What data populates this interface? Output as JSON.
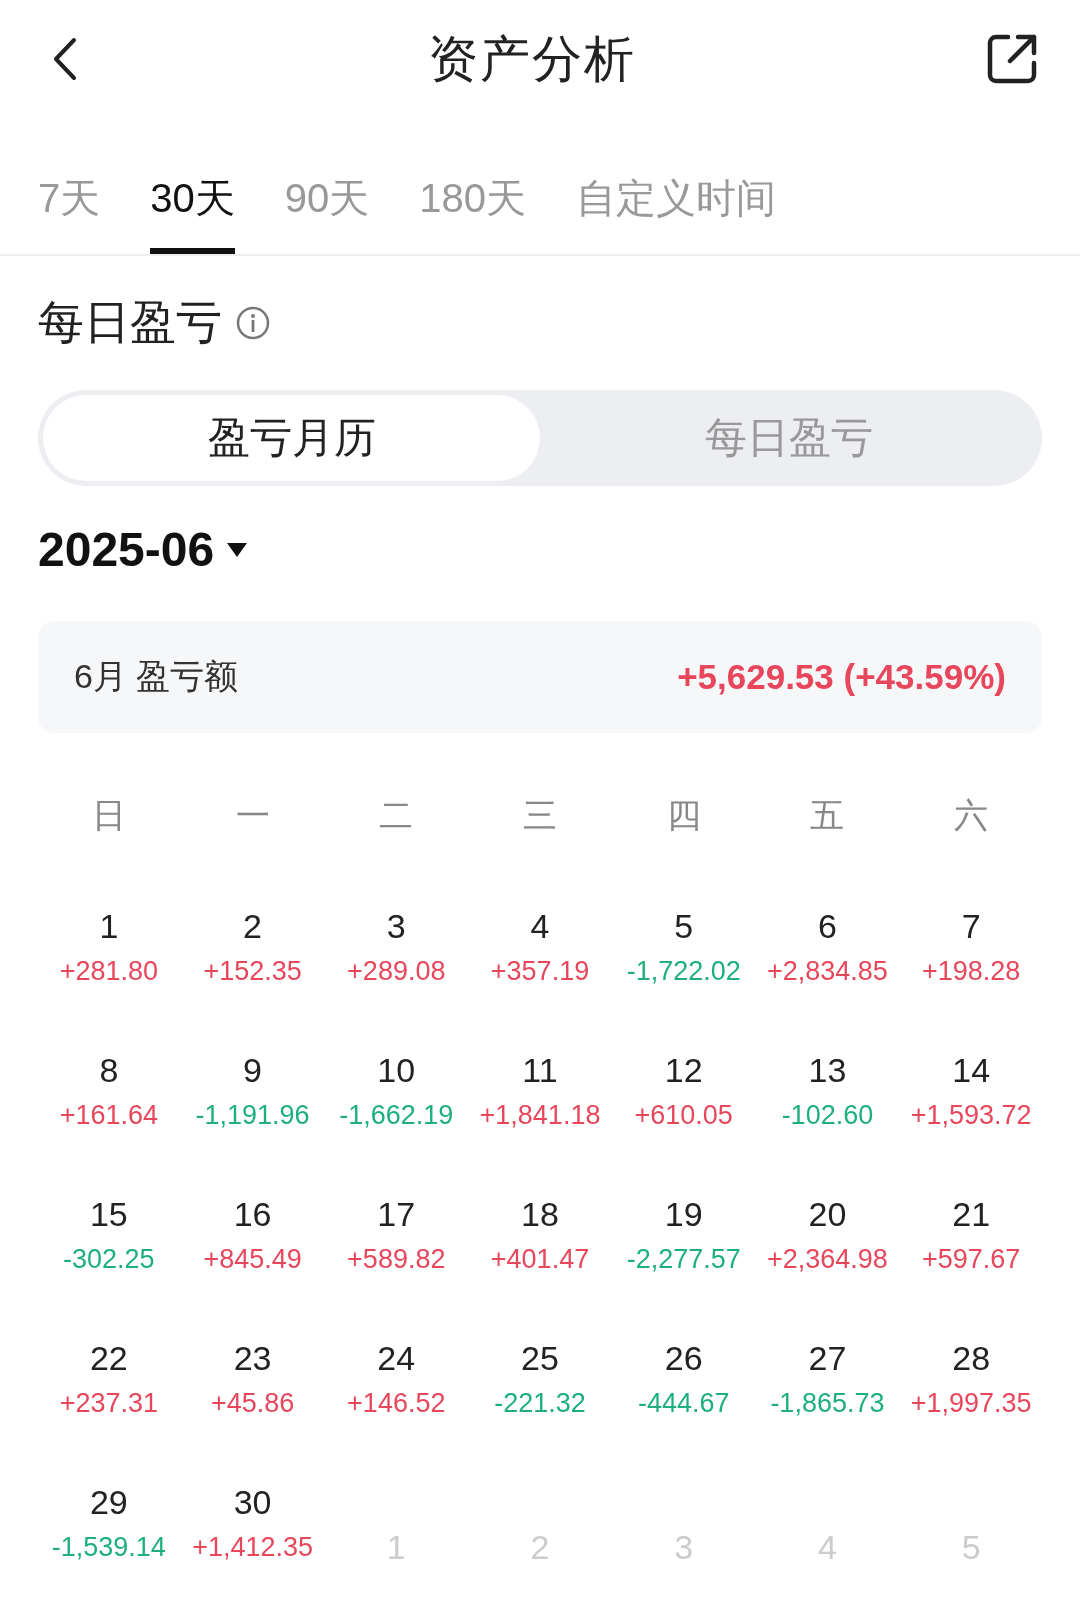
{
  "header": {
    "title": "资产分析"
  },
  "tabs": [
    {
      "label": "7天",
      "selected": false
    },
    {
      "label": "30天",
      "selected": true
    },
    {
      "label": "90天",
      "selected": false
    },
    {
      "label": "180天",
      "selected": false
    },
    {
      "label": "自定义时间",
      "selected": false
    }
  ],
  "section": {
    "title": "每日盈亏"
  },
  "view_switch": [
    {
      "label": "盈亏月历",
      "selected": true
    },
    {
      "label": "每日盈亏",
      "selected": false
    }
  ],
  "month": "2025-06",
  "summary": {
    "label": "6月 盈亏额",
    "value": "+5,629.53 (+43.59%)",
    "color": "#e8465b"
  },
  "weekdays": [
    "日",
    "一",
    "二",
    "三",
    "四",
    "五",
    "六"
  ],
  "days": [
    {
      "kind": "day",
      "day": "1",
      "value": "+281.80",
      "color": "#e8465b"
    },
    {
      "kind": "day",
      "day": "2",
      "value": "+152.35",
      "color": "#e8465b"
    },
    {
      "kind": "day",
      "day": "3",
      "value": "+289.08",
      "color": "#e8465b"
    },
    {
      "kind": "day",
      "day": "4",
      "value": "+357.19",
      "color": "#e8465b"
    },
    {
      "kind": "day",
      "day": "5",
      "value": "-1,722.02",
      "color": "#1eb07c"
    },
    {
      "kind": "day",
      "day": "6",
      "value": "+2,834.85",
      "color": "#e8465b"
    },
    {
      "kind": "day",
      "day": "7",
      "value": "+198.28",
      "color": "#e8465b"
    },
    {
      "kind": "day",
      "day": "8",
      "value": "+161.64",
      "color": "#e8465b"
    },
    {
      "kind": "day",
      "day": "9",
      "value": "-1,191.96",
      "color": "#1eb07c"
    },
    {
      "kind": "day",
      "day": "10",
      "value": "-1,662.19",
      "color": "#1eb07c"
    },
    {
      "kind": "day",
      "day": "11",
      "value": "+1,841.18",
      "color": "#e8465b"
    },
    {
      "kind": "day",
      "day": "12",
      "value": "+610.05",
      "color": "#e8465b"
    },
    {
      "kind": "day",
      "day": "13",
      "value": "-102.60",
      "color": "#1eb07c"
    },
    {
      "kind": "day",
      "day": "14",
      "value": "+1,593.72",
      "color": "#e8465b"
    },
    {
      "kind": "day",
      "day": "15",
      "value": "-302.25",
      "color": "#1eb07c"
    },
    {
      "kind": "day",
      "day": "16",
      "value": "+845.49",
      "color": "#e8465b"
    },
    {
      "kind": "day",
      "day": "17",
      "value": "+589.82",
      "color": "#e8465b"
    },
    {
      "kind": "day",
      "day": "18",
      "value": "+401.47",
      "color": "#e8465b"
    },
    {
      "kind": "day",
      "day": "19",
      "value": "-2,277.57",
      "color": "#1eb07c"
    },
    {
      "kind": "day",
      "day": "20",
      "value": "+2,364.98",
      "color": "#e8465b"
    },
    {
      "kind": "day",
      "day": "21",
      "value": "+597.67",
      "color": "#e8465b"
    },
    {
      "kind": "day",
      "day": "22",
      "value": "+237.31",
      "color": "#e8465b"
    },
    {
      "kind": "day",
      "day": "23",
      "value": "+45.86",
      "color": "#e8465b"
    },
    {
      "kind": "day",
      "day": "24",
      "value": "+146.52",
      "color": "#e8465b"
    },
    {
      "kind": "day",
      "day": "25",
      "value": "-221.32",
      "color": "#1eb07c"
    },
    {
      "kind": "day",
      "day": "26",
      "value": "-444.67",
      "color": "#1eb07c"
    },
    {
      "kind": "day",
      "day": "27",
      "value": "-1,865.73",
      "color": "#1eb07c"
    },
    {
      "kind": "day",
      "day": "28",
      "value": "+1,997.35",
      "color": "#e8465b"
    },
    {
      "kind": "day",
      "day": "29",
      "value": "-1,539.14",
      "color": "#1eb07c"
    },
    {
      "kind": "day",
      "day": "30",
      "value": "+1,412.35",
      "color": "#e8465b"
    },
    {
      "kind": "other_month",
      "day": "1"
    },
    {
      "kind": "other_month",
      "day": "2"
    },
    {
      "kind": "other_month",
      "day": "3"
    },
    {
      "kind": "other_month",
      "day": "4"
    },
    {
      "kind": "other_month",
      "day": "5"
    }
  ]
}
